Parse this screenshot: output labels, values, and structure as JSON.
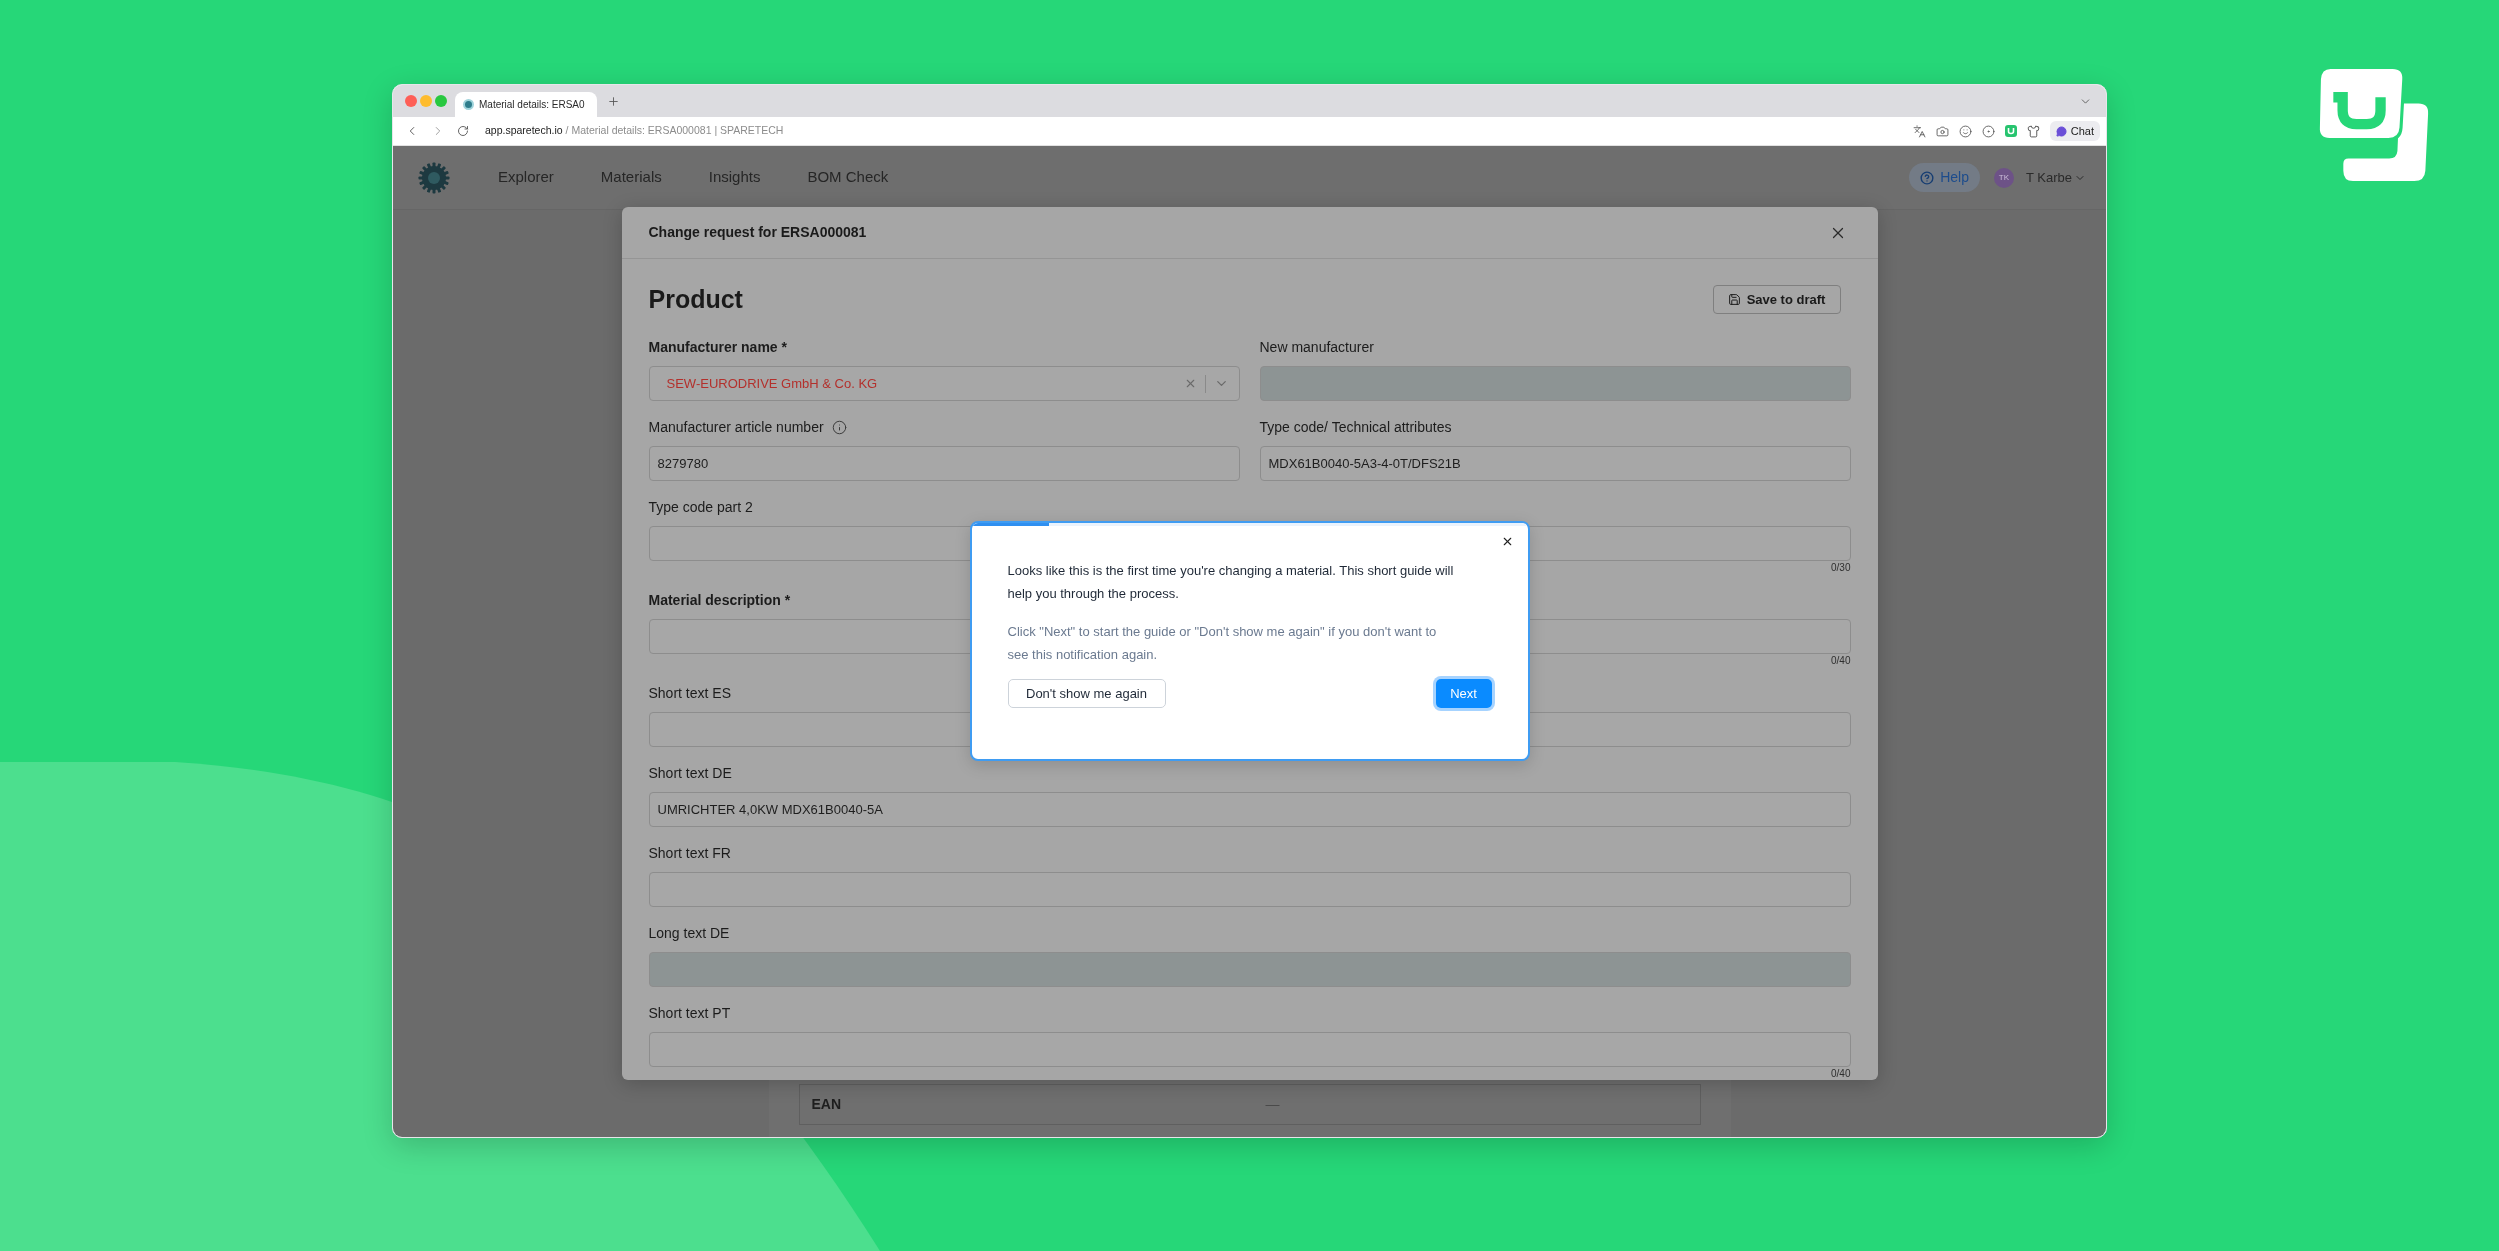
{
  "browser": {
    "tab_title": "Material details: ERSA0",
    "url": {
      "host": "app.sparetech.io",
      "path": "/ Material details: ERSA000081 | SPARETECH"
    },
    "chat_button": "Chat"
  },
  "nav": {
    "items": [
      {
        "label": "Explorer"
      },
      {
        "label": "Materials"
      },
      {
        "label": "Insights"
      },
      {
        "label": "BOM Check"
      }
    ],
    "help_button": "Help",
    "user": {
      "initials": "TK",
      "name": "T Karbe"
    }
  },
  "page_table": {
    "rows": [
      {
        "label": "EAN",
        "value": "—"
      }
    ]
  },
  "modal": {
    "title": "Change request for ERSA000081",
    "section_title": "Product",
    "save_button": "Save to draft",
    "rows": [
      {
        "fields": [
          {
            "label": "Manufacturer name *",
            "required": true,
            "kind": "select",
            "value": "SEW-EURODRIVE GmbH & Co. KG",
            "invalid": true,
            "disabled": false
          },
          {
            "label": "New manufacturer",
            "required": false,
            "kind": "text",
            "disabled": true
          }
        ]
      },
      {
        "fields": [
          {
            "label": "Manufacturer article number",
            "required": false,
            "info": true,
            "kind": "text",
            "value": "8279780",
            "disabled": false
          },
          {
            "label": "Type code/ Technical attributes",
            "required": false,
            "kind": "text",
            "value": "MDX61B0040-5A3-4-0T/DFS21B",
            "disabled": false
          }
        ]
      },
      {
        "fields": [
          {
            "label": "Type code part 2",
            "required": false,
            "kind": "text",
            "disabled": false,
            "counter": "0/30"
          }
        ]
      },
      {
        "fields": [
          {
            "label": "Material description *",
            "required": true,
            "kind": "text",
            "disabled": false,
            "counter": "0/40"
          }
        ]
      },
      {
        "fields": [
          {
            "label": "Short text ES",
            "required": false,
            "kind": "text",
            "disabled": false
          }
        ]
      },
      {
        "fields": [
          {
            "label": "Short text DE",
            "required": false,
            "kind": "text",
            "value": "UMRICHTER 4,0KW MDX61B0040-5A",
            "disabled": false
          }
        ]
      },
      {
        "fields": [
          {
            "label": "Short text FR",
            "required": false,
            "kind": "text",
            "disabled": false
          }
        ]
      },
      {
        "fields": [
          {
            "label": "Long text DE",
            "required": false,
            "kind": "text",
            "disabled": true
          }
        ]
      },
      {
        "fields": [
          {
            "label": "Short text PT",
            "required": false,
            "kind": "text",
            "disabled": false,
            "counter": "0/40"
          }
        ]
      }
    ]
  },
  "guide_popup": {
    "progress": {
      "level": 0.14
    },
    "paragraphs": [
      {
        "kind": "lead",
        "text": "Looks like this is the first time you're changing a material. This short guide will help you through the process."
      },
      {
        "kind": "hint",
        "text": "Click \"Next\" to start the guide or \"Don't show me again\" if you don't want to see this notification again."
      }
    ],
    "buttons": [
      {
        "kind": "secondary",
        "label": "Don't show me again"
      },
      {
        "kind": "primary",
        "label": "Next"
      }
    ]
  }
}
